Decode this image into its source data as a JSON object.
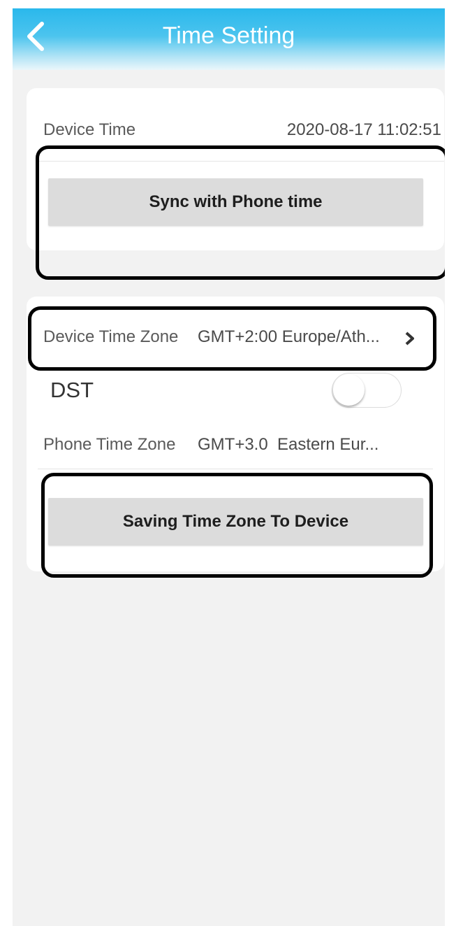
{
  "header": {
    "title": "Time Setting",
    "back_icon": "chevron-left-icon"
  },
  "device_time": {
    "label": "Device Time",
    "value": "2020-08-17 11:02:51"
  },
  "sync_button": {
    "label": "Sync with Phone time"
  },
  "device_time_zone": {
    "label": "Device Time Zone",
    "value": "GMT+2:00 Europe/Ath...",
    "chevron_icon": "chevron-right-icon"
  },
  "dst": {
    "label": "DST",
    "enabled": false
  },
  "phone_time_zone": {
    "label": "Phone Time Zone",
    "value": "GMT+3.0  Eastern Eur..."
  },
  "save_button": {
    "label": "Saving Time Zone To Device"
  },
  "colors": {
    "header": "#2ab8ec",
    "background": "#f2f2f2",
    "button": "#dcdcdc",
    "callout": "#000000"
  }
}
